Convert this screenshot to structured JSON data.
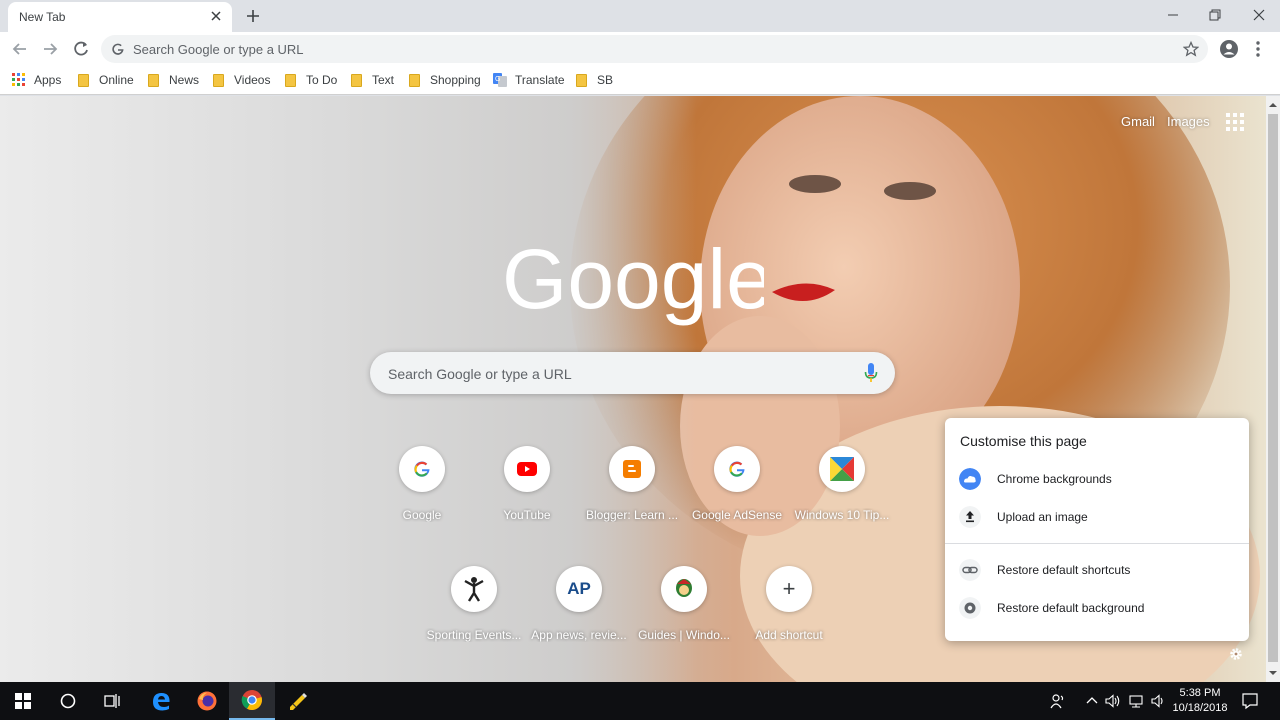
{
  "tab": {
    "title": "New Tab"
  },
  "omnibox": {
    "placeholder": "Search Google or type a URL"
  },
  "bookmarks": [
    {
      "label": "Apps",
      "icon": "apps-grid-icon"
    },
    {
      "label": "Online",
      "icon": "folder-icon"
    },
    {
      "label": "News",
      "icon": "folder-icon"
    },
    {
      "label": "Videos",
      "icon": "folder-icon"
    },
    {
      "label": "To Do",
      "icon": "folder-icon"
    },
    {
      "label": "Text",
      "icon": "folder-icon"
    },
    {
      "label": "Shopping",
      "icon": "folder-icon"
    },
    {
      "label": "Translate",
      "icon": "google-translate-icon"
    },
    {
      "label": "SB",
      "icon": "folder-icon"
    }
  ],
  "ntp": {
    "gmail": "Gmail",
    "images": "Images",
    "logo_text": "Google",
    "search_placeholder": "Search Google or type a URL",
    "shortcuts_row1": [
      {
        "label": "Google",
        "icon": "google-icon"
      },
      {
        "label": "YouTube",
        "icon": "youtube-icon"
      },
      {
        "label": "Blogger: Learn ...",
        "icon": "blogger-icon"
      },
      {
        "label": "Google AdSense",
        "icon": "google-icon"
      },
      {
        "label": "Windows 10 Tip...",
        "icon": "windows-tips-icon"
      }
    ],
    "shortcuts_row2": [
      {
        "label": "Sporting Events...",
        "icon": "sporting-figure-icon"
      },
      {
        "label": "App news, revie...",
        "icon": "ap-logo-icon",
        "glyph": "AP"
      },
      {
        "label": "Guides | Windo...",
        "icon": "guides-logo-icon"
      },
      {
        "label": "Add shortcut",
        "icon": "plus-icon",
        "glyph": "+"
      }
    ]
  },
  "customise": {
    "title": "Customise this page",
    "items": [
      {
        "label": "Chrome backgrounds",
        "icon": "cloud-icon"
      },
      {
        "label": "Upload an image",
        "icon": "upload-icon"
      },
      {
        "label": "Restore default shortcuts",
        "icon": "link-icon"
      },
      {
        "label": "Restore default background",
        "icon": "chrome-icon"
      }
    ]
  },
  "taskbar": {
    "time": "5:38 PM",
    "date": "10/18/2018"
  },
  "colors": {
    "google_blue": "#4285f4",
    "google_red": "#ea4335",
    "google_yellow": "#fbbc05",
    "google_green": "#34a853",
    "taskbar": "#0e0f12"
  }
}
